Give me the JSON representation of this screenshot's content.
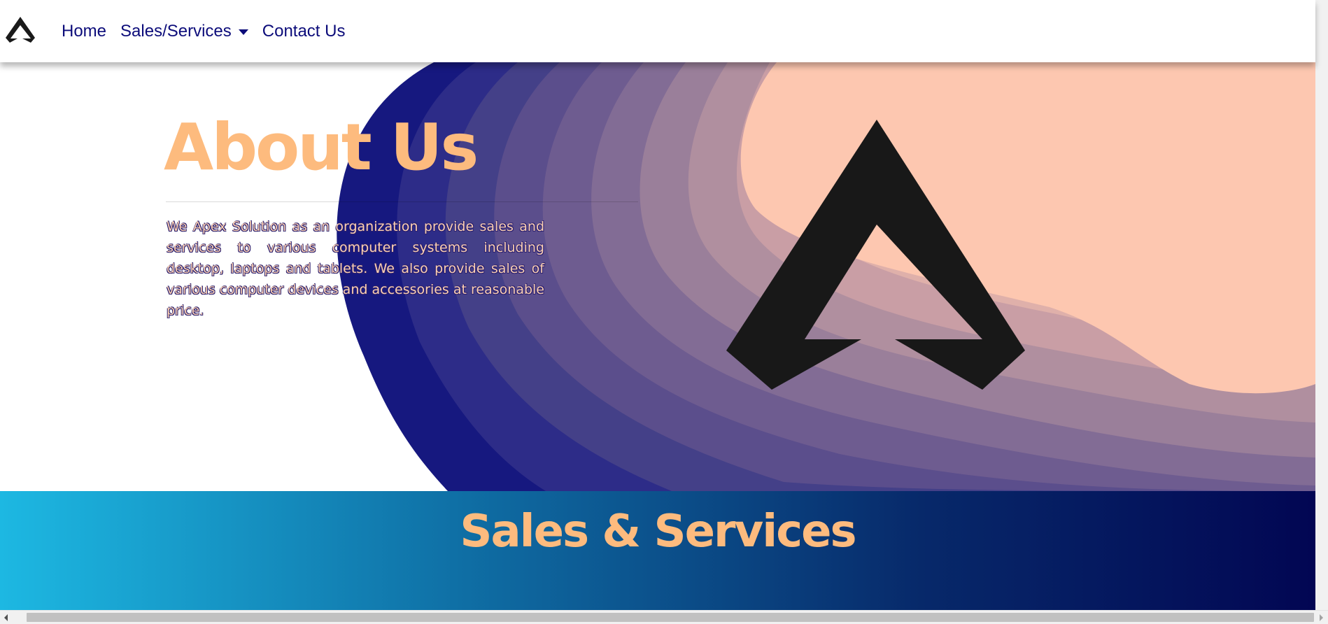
{
  "navbar": {
    "logo_icon": "apex-logo-icon",
    "links": {
      "home": "Home",
      "sales_services": "Sales/Services",
      "contact_us": "Contact Us"
    },
    "link_color": "#0c0c7a"
  },
  "about": {
    "title": "About Us",
    "text": "We Apex Solution as an organization provide sales and services to various computer systems including desktop, laptops and tablets. We also provide sales of various computer devices and accessories at reasonable price.",
    "title_color": "#fdbb7e",
    "logo_icon": "apex-logo-icon"
  },
  "sales": {
    "title": "Sales & Services",
    "gradient_colors": [
      "#1db8e2",
      "#0f6fa5",
      "#07296a",
      "#020653"
    ]
  },
  "colors": {
    "peach": "#fdc7b0",
    "navy": "#16187f",
    "logo": "#181818"
  }
}
